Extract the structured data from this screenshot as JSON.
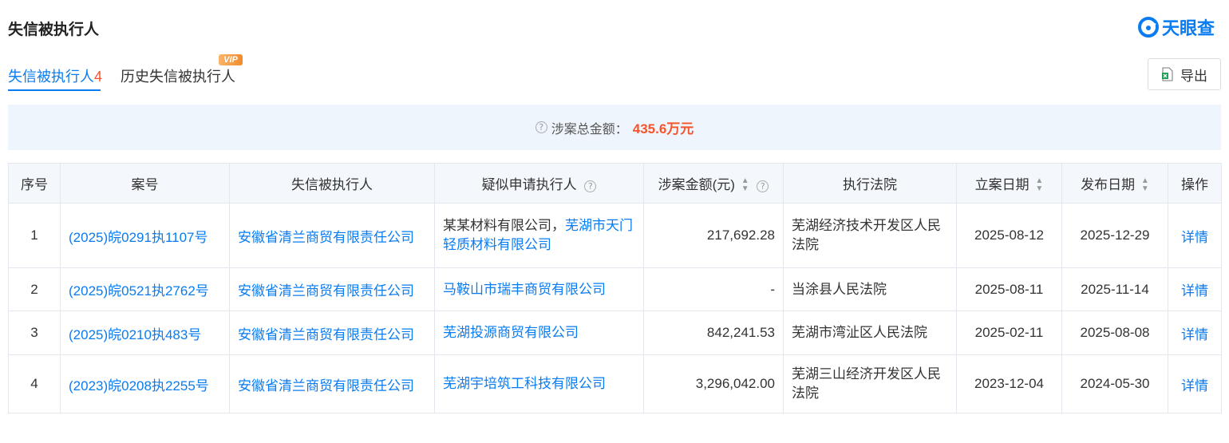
{
  "header": {
    "title": "失信被执行人",
    "logo_text": "天眼查"
  },
  "tabs": [
    {
      "label": "失信被执行人",
      "count": "4"
    },
    {
      "label": "历史失信被执行人",
      "badge": "VIP"
    }
  ],
  "toolbar": {
    "export_label": "导出"
  },
  "summary": {
    "label": "涉案总金额：",
    "amount": "435.6万元"
  },
  "table": {
    "columns": [
      "序号",
      "案号",
      "失信被执行人",
      "疑似申请执行人",
      "涉案金额(元)",
      "执行法院",
      "立案日期",
      "发布日期",
      "操作"
    ],
    "rows": [
      {
        "index": "1",
        "case_no": "(2025)皖0291执1107号",
        "debtor": "安徽省清兰商贸有限责任公司",
        "applicant_plain": "某某材料有限公司，",
        "applicant_link": "芜湖市天门轻质材料有限公司",
        "amount": "217,692.28",
        "court": "芜湖经济技术开发区人民法院",
        "filed_date": "2025-08-12",
        "published_date": "2025-12-29",
        "action": "详情"
      },
      {
        "index": "2",
        "case_no": "(2025)皖0521执2762号",
        "debtor": "安徽省清兰商贸有限责任公司",
        "applicant_plain": "",
        "applicant_link": "马鞍山市瑞丰商贸有限公司",
        "amount": "-",
        "court": "当涂县人民法院",
        "filed_date": "2025-08-11",
        "published_date": "2025-11-14",
        "action": "详情"
      },
      {
        "index": "3",
        "case_no": "(2025)皖0210执483号",
        "debtor": "安徽省清兰商贸有限责任公司",
        "applicant_plain": "",
        "applicant_link": "芜湖投源商贸有限公司",
        "amount": "842,241.53",
        "court": "芜湖市湾沚区人民法院",
        "filed_date": "2025-02-11",
        "published_date": "2025-08-08",
        "action": "详情"
      },
      {
        "index": "4",
        "case_no": "(2023)皖0208执2255号",
        "debtor": "安徽省清兰商贸有限责任公司",
        "applicant_plain": "",
        "applicant_link": "芜湖宇培筑工科技有限公司",
        "amount": "3,296,042.00",
        "court": "芜湖三山经济开发区人民法院",
        "filed_date": "2023-12-04",
        "published_date": "2024-05-30",
        "action": "详情"
      }
    ]
  },
  "colors": {
    "accent": "#0a7cf1",
    "highlight": "#f5542d"
  },
  "icons": {
    "help": "question-circle-icon",
    "export": "excel-icon",
    "sort": "sort-arrows-icon"
  }
}
